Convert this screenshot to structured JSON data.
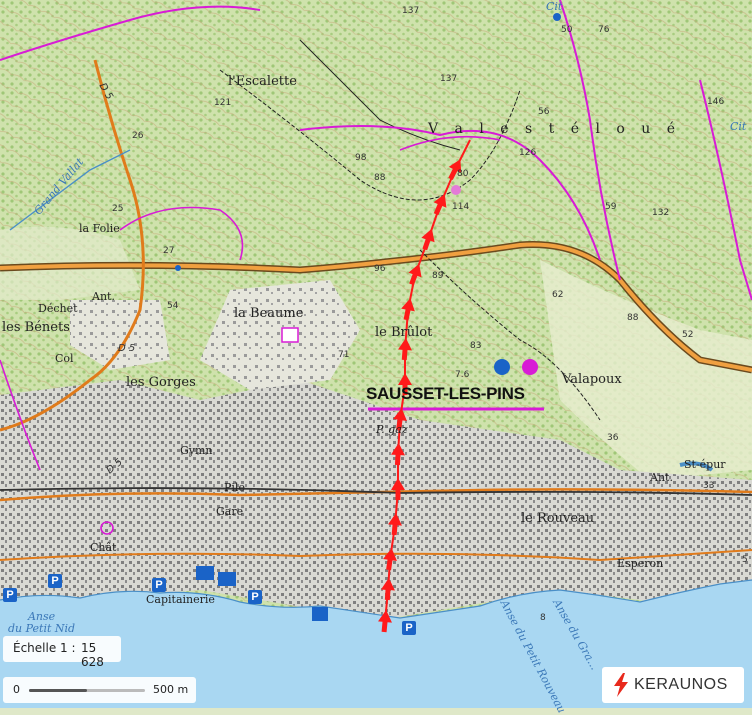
{
  "map": {
    "labels": {
      "escalette": "l'Escalette",
      "vallon": "V a l e s t é l o u é",
      "la_folie": "la Folie",
      "dechet": "Déchet",
      "les_benets": "les Bénets",
      "la_beaume": "la Beaume",
      "le_brulot": "le Brûlot",
      "les_gorges": "les Gorges",
      "valapoux": "Valapoux",
      "town": "SAUSSET-LES-PINS",
      "p_gaz": "P. gaz",
      "gymn": "Gymn",
      "pile": "Pile",
      "gare": "Gare",
      "chat": "Chât",
      "le_rouveau": "le Rouveau",
      "esperon": "Esperon",
      "capitainerie": "Capitainerie",
      "st_epur": "St-épur",
      "ant1": "Ant.",
      "ant2": "Ant.",
      "col": "Col",
      "grand_vallat": "Grand Vallat",
      "anse_petit_nid": "Anse\ndu Petit Nid",
      "anse_petit_rouveau": "Anse du Petit Rouveau",
      "anse_grand": "Anse du Gra...",
      "cit1": "Cit",
      "cit2": "Cit",
      "d5_a": "D 5",
      "d5_b": "D 5",
      "d5_c": "D 5"
    },
    "elevations": [
      "137",
      "137",
      "121",
      "98",
      "88",
      "80",
      "114",
      "126",
      "146",
      "132",
      "59",
      "56",
      "50",
      "25",
      "27",
      "54",
      "96",
      "89",
      "71",
      "83",
      "7.6",
      "62",
      "88",
      "36",
      "8",
      "33",
      "5",
      "52",
      "76",
      "26"
    ],
    "parking_label": "P",
    "colors": {
      "trail": "#ff1a1a",
      "boundary": "#d81bd6",
      "road": "#e07b1b",
      "sea": "#a9d7f2",
      "urban": "#9b9b9b"
    }
  },
  "scale": {
    "label": "Échelle 1 :",
    "value": "15 628"
  },
  "scalebar": {
    "start": "0",
    "end": "500 m"
  },
  "brand": {
    "name": "KERAUNOS",
    "icon": "lightning-bolt-icon"
  }
}
